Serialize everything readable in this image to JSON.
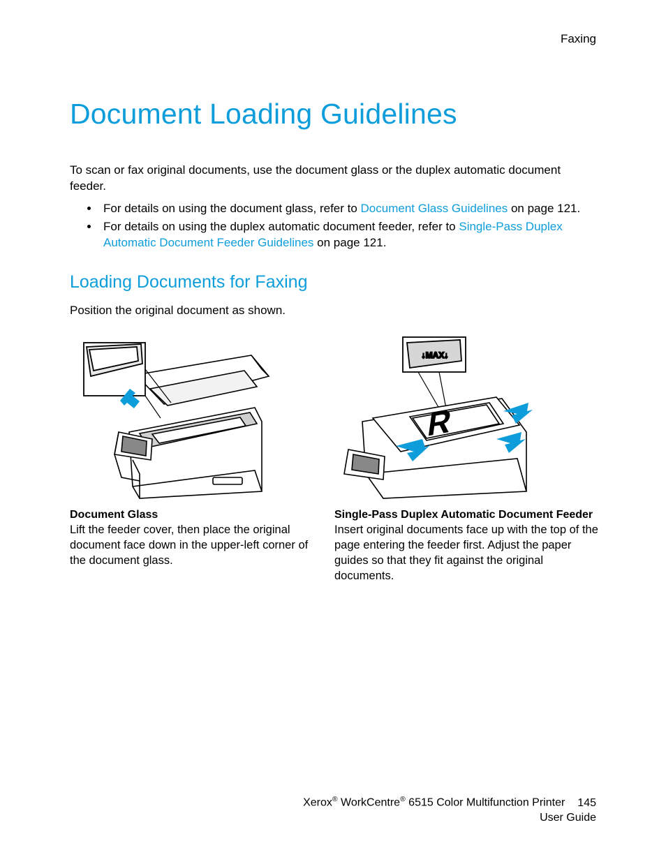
{
  "header": {
    "section": "Faxing"
  },
  "title": "Document Loading Guidelines",
  "intro": "To scan or fax original documents, use the document glass or the duplex automatic document feeder.",
  "bullets": [
    {
      "pre": "For details on using the document glass, refer to ",
      "link": "Document Glass Guidelines",
      "post": " on page 121."
    },
    {
      "pre": "For details on using the duplex automatic document feeder, refer to ",
      "link": "Single-Pass Duplex Automatic Document Feeder Guidelines",
      "post": " on page 121."
    }
  ],
  "subheading": "Loading Documents for Faxing",
  "instruction": "Position the original document as shown.",
  "columns": {
    "left": {
      "title": "Document Glass",
      "body": "Lift the feeder cover, then place the original document face down in the upper-left corner of the document glass."
    },
    "right": {
      "title": "Single-Pass Duplex Automatic Document Feeder",
      "body": "Insert original documents face up with the top of the page entering the feeder first. Adjust the paper guides so that they fit against the original documents."
    }
  },
  "footer": {
    "line1_a": "Xerox",
    "line1_b": " WorkCentre",
    "line1_c": " 6515 Color Multifunction Printer",
    "page": "145",
    "line2": "User Guide"
  },
  "icons": {
    "printer_glass": "printer-document-glass-illustration",
    "printer_adf": "printer-adf-illustration"
  }
}
